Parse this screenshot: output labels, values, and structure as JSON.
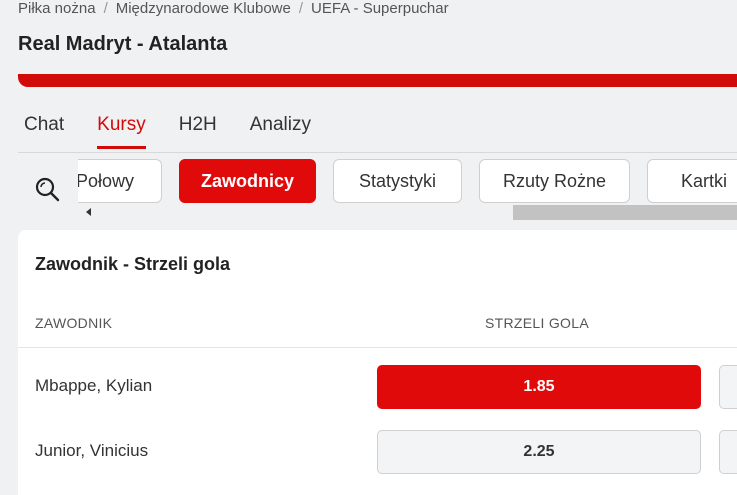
{
  "breadcrumb": {
    "items": [
      "Piłka nożna",
      "Międzynarodowe Klubowe",
      "UEFA - Superpuchar"
    ],
    "separator": "/"
  },
  "page_title": "Real Madryt - Atalanta",
  "tabs": [
    {
      "label": "Chat"
    },
    {
      "label": "Kursy"
    },
    {
      "label": "H2H"
    },
    {
      "label": "Analizy"
    }
  ],
  "chips": [
    {
      "label": "Połowy"
    },
    {
      "label": "Zawodnicy"
    },
    {
      "label": "Statystyki"
    },
    {
      "label": "Rzuty Rożne"
    },
    {
      "label": "Kartki"
    }
  ],
  "market": {
    "title": "Zawodnik - Strzeli gola",
    "col_player": "ZAWODNIK",
    "col_goal": "STRZELI GOLA",
    "rows": [
      {
        "player": "Mbappe, Kylian",
        "odd": "1.85"
      },
      {
        "player": "Junior, Vinicius",
        "odd": "2.25"
      }
    ]
  },
  "colors": {
    "accent": "#e00a0a",
    "bar": "#d10a0a"
  },
  "icons": {
    "search": "search-icon",
    "scroll_left": "caret-left-icon"
  }
}
